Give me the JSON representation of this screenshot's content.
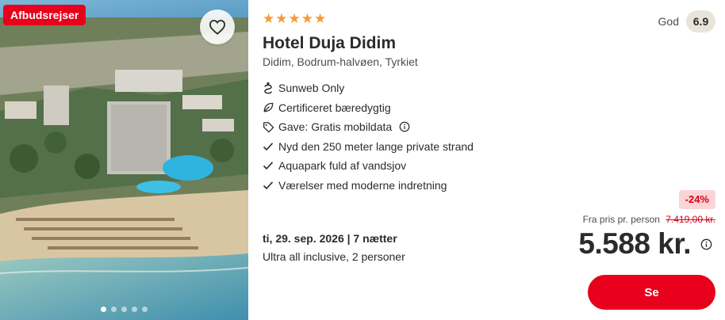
{
  "image": {
    "deal_badge": "Afbudsrejser",
    "favorite_icon": "heart-outline-icon",
    "carousel": {
      "count": 5,
      "active_index": 0
    }
  },
  "hotel": {
    "stars": 5,
    "star_glyph": "★",
    "name": "Hotel Duja Didim",
    "location": "Didim, Bodrum-halvøen, Tyrkiet"
  },
  "rating": {
    "label": "God",
    "score": "6.9"
  },
  "features": [
    {
      "icon": "sunweb-only-icon",
      "text": "Sunweb Only",
      "has_info": false
    },
    {
      "icon": "leaf-icon",
      "text": "Certificeret bæredygtig",
      "has_info": false
    },
    {
      "icon": "tag-icon",
      "text": "Gave: Gratis mobildata",
      "has_info": true
    },
    {
      "icon": "checkmark-icon",
      "text": "Nyd den 250 meter lange private strand",
      "has_info": false
    },
    {
      "icon": "checkmark-icon",
      "text": "Aquapark fuld af vandsjov",
      "has_info": false
    },
    {
      "icon": "checkmark-icon",
      "text": "Værelser med moderne indretning",
      "has_info": false
    }
  ],
  "trip": {
    "date": "ti, 29. sep. 2026 | 7 nætter",
    "board": "Ultra all inclusive, 2 personer"
  },
  "pricing": {
    "discount": "-24%",
    "from_label": "Fra pris pr. person",
    "old_price": "7.419,00 kr.",
    "price": "5.588 kr."
  },
  "cta": {
    "label": "Se"
  },
  "colors": {
    "brand_red": "#e8001c",
    "star_orange": "#f49a33",
    "score_bg": "#e9e4da",
    "discount_bg": "#fbd5d6"
  }
}
